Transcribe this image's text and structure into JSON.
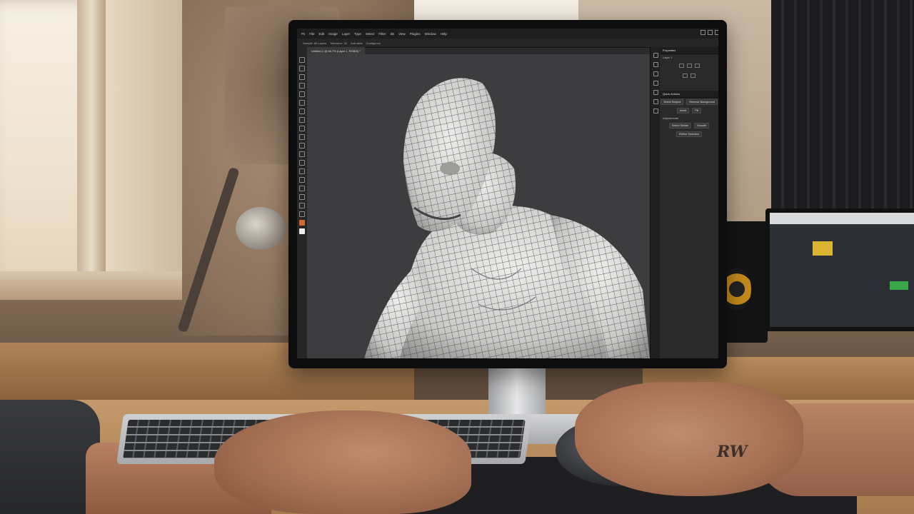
{
  "app": {
    "menu": [
      "Ps",
      "File",
      "Edit",
      "Image",
      "Layer",
      "Type",
      "Select",
      "Filter",
      "3D",
      "View",
      "Plugins",
      "Window",
      "Help"
    ],
    "doc_tab": "Untitled-1 @ 66.7% (Layer 1, RGB/8) *",
    "options": [
      "Sample: All Layers",
      "Tolerance: 32",
      "Anti-alias",
      "Contiguous"
    ],
    "right_panels": {
      "properties_title": "Properties",
      "layer_row": "Layer 1",
      "actions_title": "Quick Actions",
      "buttons_row1": [
        "Select Subject",
        "Remove Background"
      ],
      "buttons_row2": [
        "Invert",
        "Fill"
      ],
      "adjust_row": "Adjustments",
      "buttons_row3": [
        "Select Similar",
        "Smooth"
      ],
      "button_single": "Refine Selection"
    }
  },
  "canvas": {
    "subject": "wireframe creature model"
  },
  "tattoo_text": "RW",
  "colors": {
    "ui_dark": "#2b2b2d",
    "canvas_bg": "#3d3d3f",
    "model": "#d8d8d6",
    "mesh": "#333333"
  }
}
